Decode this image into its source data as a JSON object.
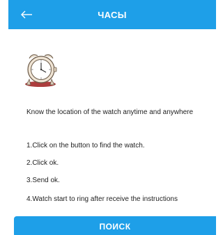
{
  "header": {
    "title": "ЧАСЫ",
    "back_icon": "arrow-left-icon",
    "bg_color": "#1e9fe8"
  },
  "illustration": {
    "icon": "alarm-clock-icon"
  },
  "instructions": {
    "intro": "Know the location of the watch anytime and anywhere",
    "steps": [
      "1.Click on the button to find the watch.",
      "2.Click ok.",
      "3.Send ok.",
      "4.Watch start to ring after receive the instructions"
    ]
  },
  "actions": {
    "search_label": "ПОИСК",
    "button_color": "#1e9fe8"
  }
}
